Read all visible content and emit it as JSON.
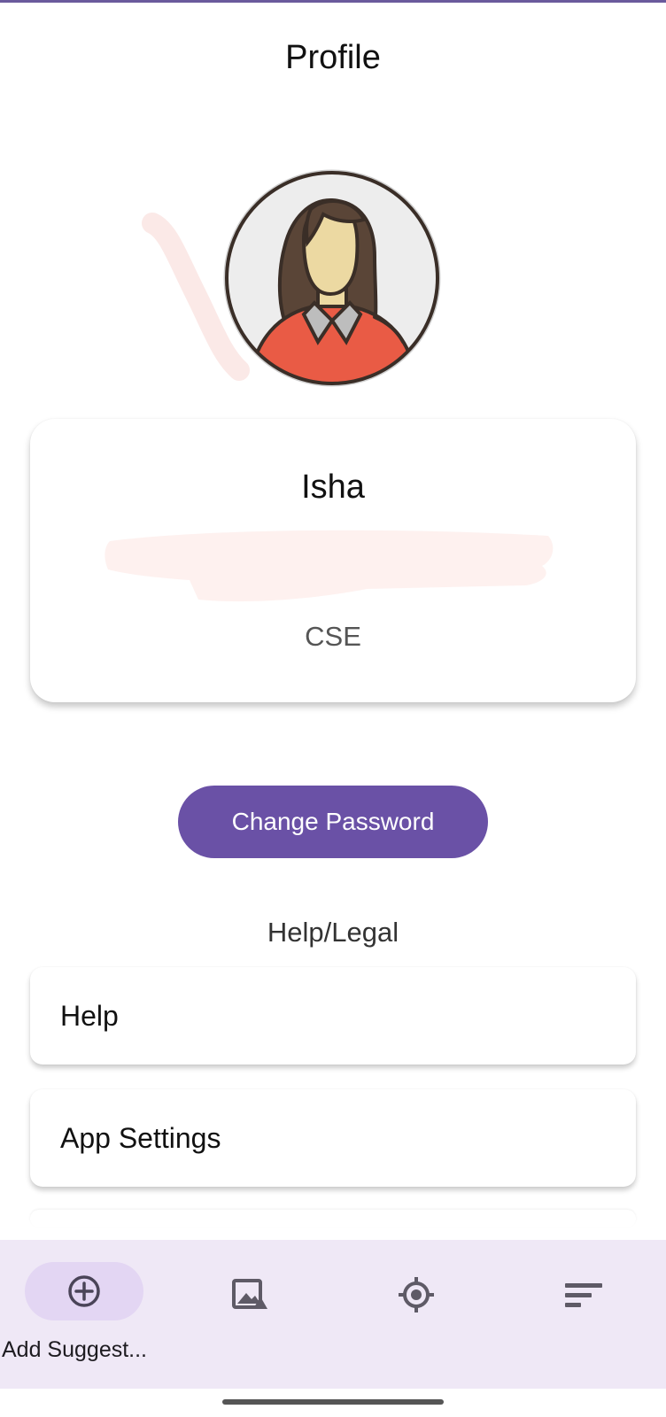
{
  "header": {
    "title": "Profile"
  },
  "profile": {
    "name": "Isha",
    "department": "CSE",
    "avatar_icon": "female-avatar-icon"
  },
  "actions": {
    "change_password_label": "Change Password"
  },
  "help_legal": {
    "section_title": "Help/Legal",
    "items": [
      {
        "label": "Help"
      },
      {
        "label": "App Settings"
      }
    ]
  },
  "bottom_nav": {
    "items": [
      {
        "label": "Add Suggest...",
        "icon": "add-circle-icon",
        "selected": true
      },
      {
        "label": "",
        "icon": "image-icon",
        "selected": false
      },
      {
        "label": "",
        "icon": "gps-target-icon",
        "selected": false
      },
      {
        "label": "",
        "icon": "sort-icon",
        "selected": false
      }
    ]
  },
  "colors": {
    "accent": "#6a51a6",
    "nav_background": "#efe8f6",
    "nav_selected_pill": "#e3d6f3"
  }
}
